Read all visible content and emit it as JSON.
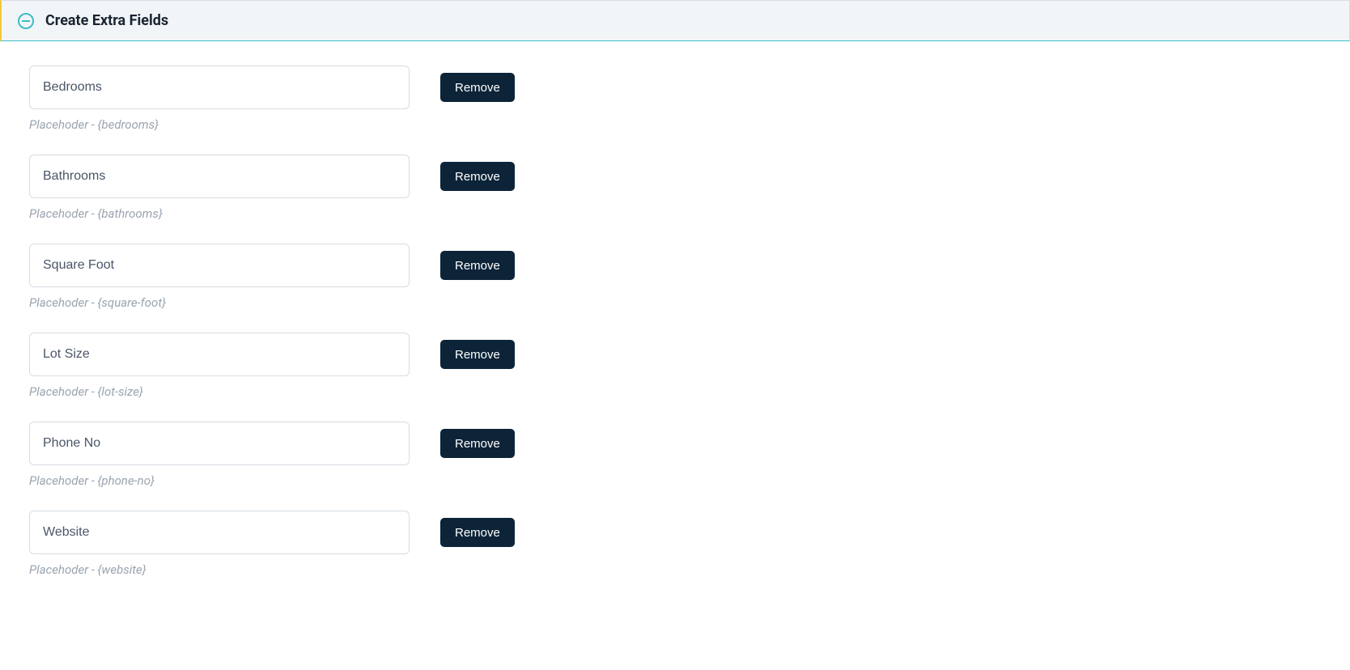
{
  "panel": {
    "title": "Create Extra Fields"
  },
  "fields": [
    {
      "value": "Bedrooms",
      "hint": "Placehoder - {bedrooms}",
      "remove": "Remove"
    },
    {
      "value": "Bathrooms",
      "hint": "Placehoder - {bathrooms}",
      "remove": "Remove"
    },
    {
      "value": "Square Foot",
      "hint": "Placehoder - {square-foot}",
      "remove": "Remove"
    },
    {
      "value": "Lot Size",
      "hint": "Placehoder - {lot-size}",
      "remove": "Remove"
    },
    {
      "value": "Phone No",
      "hint": "Placehoder - {phone-no}",
      "remove": "Remove"
    },
    {
      "value": "Website",
      "hint": "Placehoder - {website}",
      "remove": "Remove"
    }
  ]
}
